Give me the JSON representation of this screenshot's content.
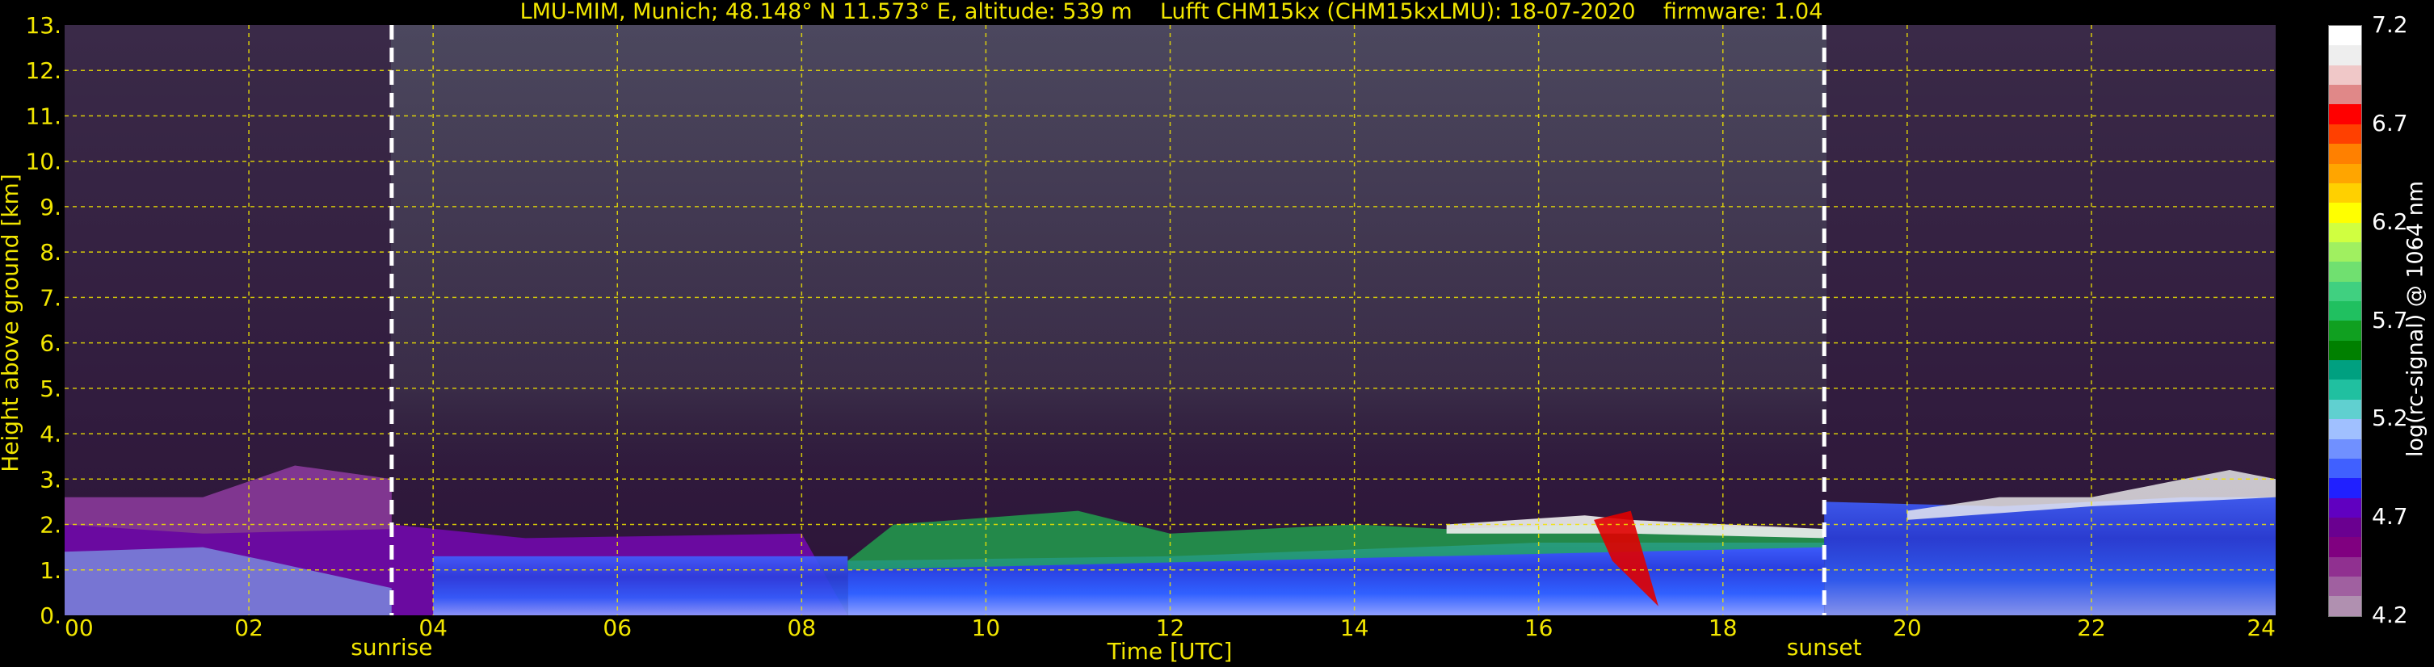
{
  "title": "LMU-MIM, Munich; 48.148° N 11.573° E, altitude: 539 m    Lufft CHM15kx (CHM15kxLMU): 18-07-2020    firmware: 1.04",
  "chart_data": {
    "type": "heatmap",
    "title": "LMU-MIM, Munich; 48.148° N 11.573° E, altitude: 539 m    Lufft CHM15kx (CHM15kxLMU): 18-07-2020    firmware: 1.04",
    "xlabel": "Time [UTC]",
    "ylabel": "Height above ground [km]",
    "xlim": [
      0,
      24
    ],
    "ylim": [
      0,
      13
    ],
    "x_ticks": [
      "00",
      "02",
      "04",
      "06",
      "08",
      "10",
      "12",
      "14",
      "16",
      "18",
      "20",
      "22",
      "24"
    ],
    "y_ticks": [
      "0.",
      "1.",
      "2.",
      "3.",
      "4.",
      "5.",
      "6.",
      "7.",
      "8.",
      "9.",
      "10.",
      "11.",
      "12.",
      "13."
    ],
    "grid": true,
    "annotations": [
      {
        "text": "sunrise",
        "x": 3.55
      },
      {
        "text": "sunset",
        "x": 19.1
      }
    ],
    "colorbar": {
      "label": "log(rc-signal) @ 1064 nm",
      "range": [
        4.2,
        7.2
      ],
      "tick_labels": [
        "4.2",
        "4.7",
        "5.2",
        "5.7",
        "6.2",
        "6.7",
        "7.2"
      ],
      "colors": [
        "#ffffff",
        "#eeeeee",
        "#f0c8c8",
        "#e08888",
        "#ff0000",
        "#ff4000",
        "#ff8000",
        "#ffa500",
        "#ffd000",
        "#ffff00",
        "#d0ff40",
        "#a0f060",
        "#70e070",
        "#40d080",
        "#20c060",
        "#10a020",
        "#008000",
        "#00a080",
        "#20c0a0",
        "#60d0d0",
        "#a0c0ff",
        "#7090ff",
        "#4060ff",
        "#2020ff",
        "#6000c0",
        "#6a0090",
        "#800080",
        "#903090",
        "#a060a0",
        "#b090b0"
      ]
    }
  },
  "colors": {
    "text": "#f2e600",
    "grid": "#f2e600",
    "background": "#000000",
    "sky": "#2a1038"
  }
}
